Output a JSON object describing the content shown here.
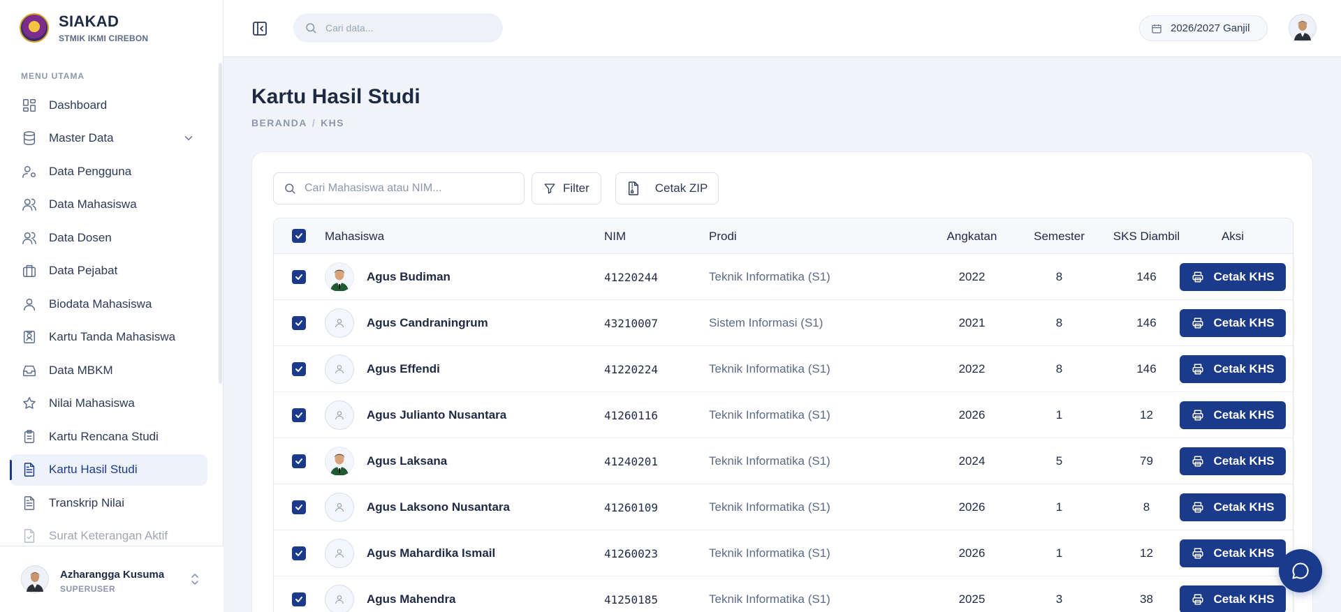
{
  "brand": {
    "title": "SIAKAD",
    "subtitle": "STMIK IKMI CIREBON"
  },
  "sidebar": {
    "heading": "MENU UTAMA",
    "items": [
      {
        "label": "Dashboard",
        "icon": "dashboard-icon"
      },
      {
        "label": "Master Data",
        "icon": "database-icon",
        "expandable": true
      },
      {
        "label": "Data Pengguna",
        "icon": "user-cog-icon"
      },
      {
        "label": "Data Mahasiswa",
        "icon": "users-icon"
      },
      {
        "label": "Data Dosen",
        "icon": "users-icon"
      },
      {
        "label": "Data Pejabat",
        "icon": "briefcase-icon"
      },
      {
        "label": "Biodata Mahasiswa",
        "icon": "user-icon"
      },
      {
        "label": "Kartu Tanda Mahasiswa",
        "icon": "id-card-icon"
      },
      {
        "label": "Data MBKM",
        "icon": "inbox-icon"
      },
      {
        "label": "Nilai Mahasiswa",
        "icon": "star-icon"
      },
      {
        "label": "Kartu Rencana Studi",
        "icon": "clipboard-list-icon"
      },
      {
        "label": "Kartu Hasil Studi",
        "icon": "file-text-icon",
        "active": true
      },
      {
        "label": "Transkrip Nilai",
        "icon": "file-text-icon"
      },
      {
        "label": "Surat Keterangan Aktif",
        "icon": "file-check-icon"
      }
    ],
    "user": {
      "name": "Azharangga Kusuma",
      "role": "SUPERUSER"
    }
  },
  "header": {
    "search_placeholder": "Cari data...",
    "period": "2026/2027 Ganjil"
  },
  "page": {
    "title": "Kartu Hasil Studi",
    "breadcrumb": [
      "BERANDA",
      "KHS"
    ]
  },
  "toolbar": {
    "search_placeholder": "Cari Mahasiswa atau NIM...",
    "filter_label": "Filter",
    "zip_label": "Cetak ZIP"
  },
  "table": {
    "columns": {
      "mahasiswa": "Mahasiswa",
      "nim": "NIM",
      "prodi": "Prodi",
      "angkatan": "Angkatan",
      "semester": "Semester",
      "sks": "SKS Diambil",
      "aksi": "Aksi"
    },
    "action_label": "Cetak KHS",
    "rows": [
      {
        "name": "Agus Budiman",
        "nim": "41220244",
        "prodi": "Teknik Informatika (S1)",
        "angkatan": "2022",
        "semester": "8",
        "sks": "146",
        "photo": true
      },
      {
        "name": "Agus Candraningrum",
        "nim": "43210007",
        "prodi": "Sistem Informasi (S1)",
        "angkatan": "2021",
        "semester": "8",
        "sks": "146",
        "photo": false
      },
      {
        "name": "Agus Effendi",
        "nim": "41220224",
        "prodi": "Teknik Informatika (S1)",
        "angkatan": "2022",
        "semester": "8",
        "sks": "146",
        "photo": false
      },
      {
        "name": "Agus Julianto Nusantara",
        "nim": "41260116",
        "prodi": "Teknik Informatika (S1)",
        "angkatan": "2026",
        "semester": "1",
        "sks": "12",
        "photo": false
      },
      {
        "name": "Agus Laksana",
        "nim": "41240201",
        "prodi": "Teknik Informatika (S1)",
        "angkatan": "2024",
        "semester": "5",
        "sks": "79",
        "photo": true
      },
      {
        "name": "Agus Laksono Nusantara",
        "nim": "41260109",
        "prodi": "Teknik Informatika (S1)",
        "angkatan": "2026",
        "semester": "1",
        "sks": "8",
        "photo": false
      },
      {
        "name": "Agus Mahardika Ismail",
        "nim": "41260023",
        "prodi": "Teknik Informatika (S1)",
        "angkatan": "2026",
        "semester": "1",
        "sks": "12",
        "photo": false
      },
      {
        "name": "Agus Mahendra",
        "nim": "41250185",
        "prodi": "Teknik Informatika (S1)",
        "angkatan": "2025",
        "semester": "3",
        "sks": "38",
        "photo": false
      }
    ]
  },
  "colors": {
    "primary": "#1b3a8a",
    "background": "#f1f4f9",
    "text": "#1e2a44",
    "muted": "#8a97ad"
  }
}
